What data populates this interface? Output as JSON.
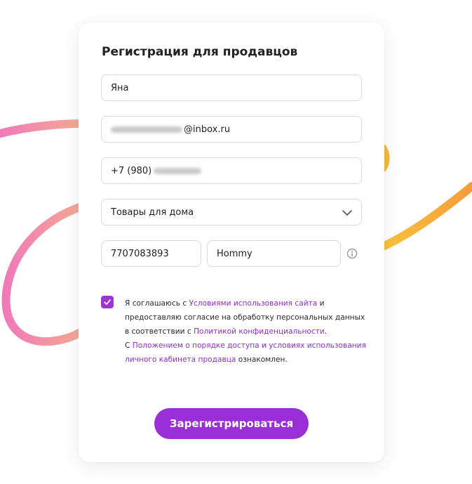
{
  "form": {
    "title": "Регистрация для продавцов",
    "name_value": "Яна",
    "email_suffix": "@inbox.ru",
    "phone_prefix": "+7 (980)",
    "category_value": "Товары для дома",
    "inn_value": "7707083893",
    "brand_value": "Hommy",
    "checkbox_checked": true,
    "consent": {
      "t1": "Я соглашаюсь с ",
      "l1": "Условиями использования сайта",
      "t2": " и предоставляю согласие на обработку персональных данных в соответствии с ",
      "l2": "Политикой конфиденциальности",
      "t3": ".",
      "t4": "С ",
      "l3": "Положением о порядке доступа и условиях использования личного кабинета продавца",
      "t5": " ознакомлен."
    },
    "submit_label": "Зарегистрироваться"
  },
  "colors": {
    "accent": "#9a2fd8",
    "link": "#8f2dc9"
  },
  "icons": {
    "category_dropdown": "chevron-down-icon",
    "brand_info": "info-icon",
    "checkbox": "check-icon"
  }
}
